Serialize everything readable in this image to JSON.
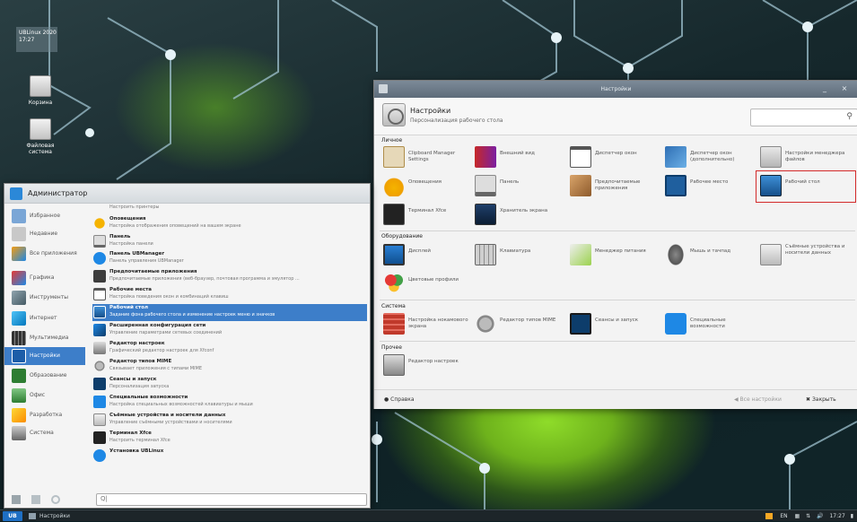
{
  "desktop": {
    "clock_text": "UBLinux 2020\n17:27",
    "icons": [
      {
        "label": "Корзина"
      },
      {
        "label": "Файловая система"
      }
    ]
  },
  "settings": {
    "window_title": "Настройки",
    "title": "Настройки",
    "subtitle": "Персонализация рабочего стола",
    "sections": [
      {
        "name": "Личное",
        "items": [
          "Clipboard Manager Settings",
          "Внешний вид",
          "Диспетчер окон",
          "Диспетчер окон (дополнительно)",
          "Настройки менеджера файлов",
          "Оповещения",
          "Панель",
          "Предпочитаемые приложения",
          "Рабочее место",
          "Рабочий стол",
          "Терминал Xfce",
          "Хранитель экрана"
        ]
      },
      {
        "name": "Оборудование",
        "items": [
          "Дисплей",
          "Клавиатура",
          "Менеджер питания",
          "Мышь и тачпад",
          "Съёмные устройства и носители данных",
          "Цветовые профили"
        ]
      },
      {
        "name": "Система",
        "items": [
          "Настройка нокамового экрана",
          "Редактор типов MIME",
          "Сеансы и запуск",
          "Специальные возможности"
        ]
      },
      {
        "name": "Прочее",
        "items": [
          "Редактор настроек"
        ]
      }
    ],
    "selected_item": "Рабочий стол",
    "buttons": {
      "help": "Справка",
      "all": "Все настройки",
      "close": "Закрыть"
    }
  },
  "menu": {
    "user": "Администратор",
    "categories": [
      "Избранное",
      "Недавние",
      "Все приложения",
      "Графика",
      "Инструменты",
      "Интернет",
      "Мультимедиа",
      "Настройки",
      "Образование",
      "Офис",
      "Разработка",
      "Система"
    ],
    "active_category": "Настройки",
    "entries": [
      {
        "title": "",
        "desc": "Настроить принтеры"
      },
      {
        "title": "Оповещения",
        "desc": "Настройка отображения оповещений на вашем экране"
      },
      {
        "title": "Панель",
        "desc": "Настройка панели"
      },
      {
        "title": "Панель UBManager",
        "desc": "Панель управления UBManager"
      },
      {
        "title": "Предпочитаемые приложения",
        "desc": "Предпочитаемые приложения (веб-браузер, почтовая программа и эмулятор ..."
      },
      {
        "title": "Рабочие места",
        "desc": "Настройка поведения окон и комбинаций клавиш"
      },
      {
        "title": "Рабочий стол",
        "desc": "Задание фона рабочего стола и изменение настроек меню и значков"
      },
      {
        "title": "Расширенная конфигурация сети",
        "desc": "Управление параметрами сетевых соединений"
      },
      {
        "title": "Редактор настроек",
        "desc": "Графический редактор настроек для Xfconf"
      },
      {
        "title": "Редактор типов MIME",
        "desc": "Связывает приложения с типами MIME"
      },
      {
        "title": "Сеансы и запуск",
        "desc": "Персонализация запуска"
      },
      {
        "title": "Специальные возможности",
        "desc": "Настройка специальных возможностей клавиатуры и мыши"
      },
      {
        "title": "Съёмные устройства и носители данных",
        "desc": "Управление съёмными устройствами и носителями"
      },
      {
        "title": "Терминал Xfce",
        "desc": "Настроить терминал Xfce"
      },
      {
        "title": "Установка UBLinux",
        "desc": ""
      }
    ],
    "active_entry": "Рабочий стол",
    "search_value": "Q|"
  },
  "taskbar": {
    "logo": "UB",
    "task": "Настройки",
    "lang": "EN",
    "time": "17:27"
  }
}
